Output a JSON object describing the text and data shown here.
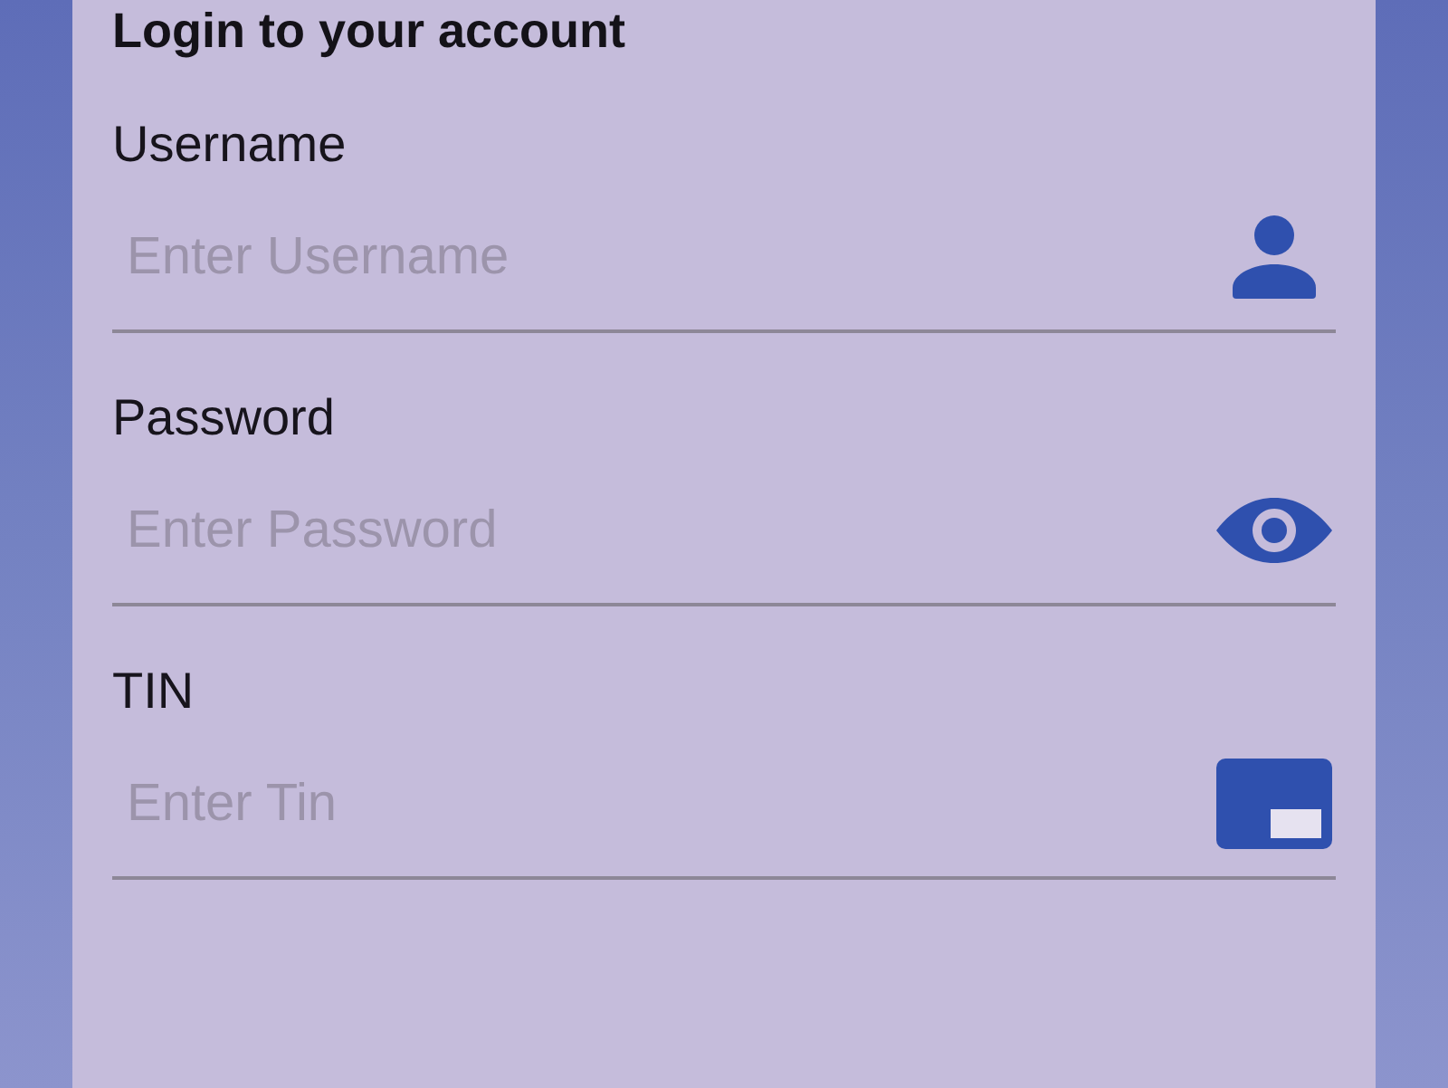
{
  "form": {
    "title": "Login to your account",
    "fields": [
      {
        "kind": "account",
        "label": "Username",
        "placeholder": "Enter Username"
      },
      {
        "kind": "password",
        "label": "Password",
        "placeholder": "Enter Password"
      },
      {
        "kind": "id",
        "label": "TIN",
        "placeholder": "Enter Tin"
      }
    ]
  }
}
